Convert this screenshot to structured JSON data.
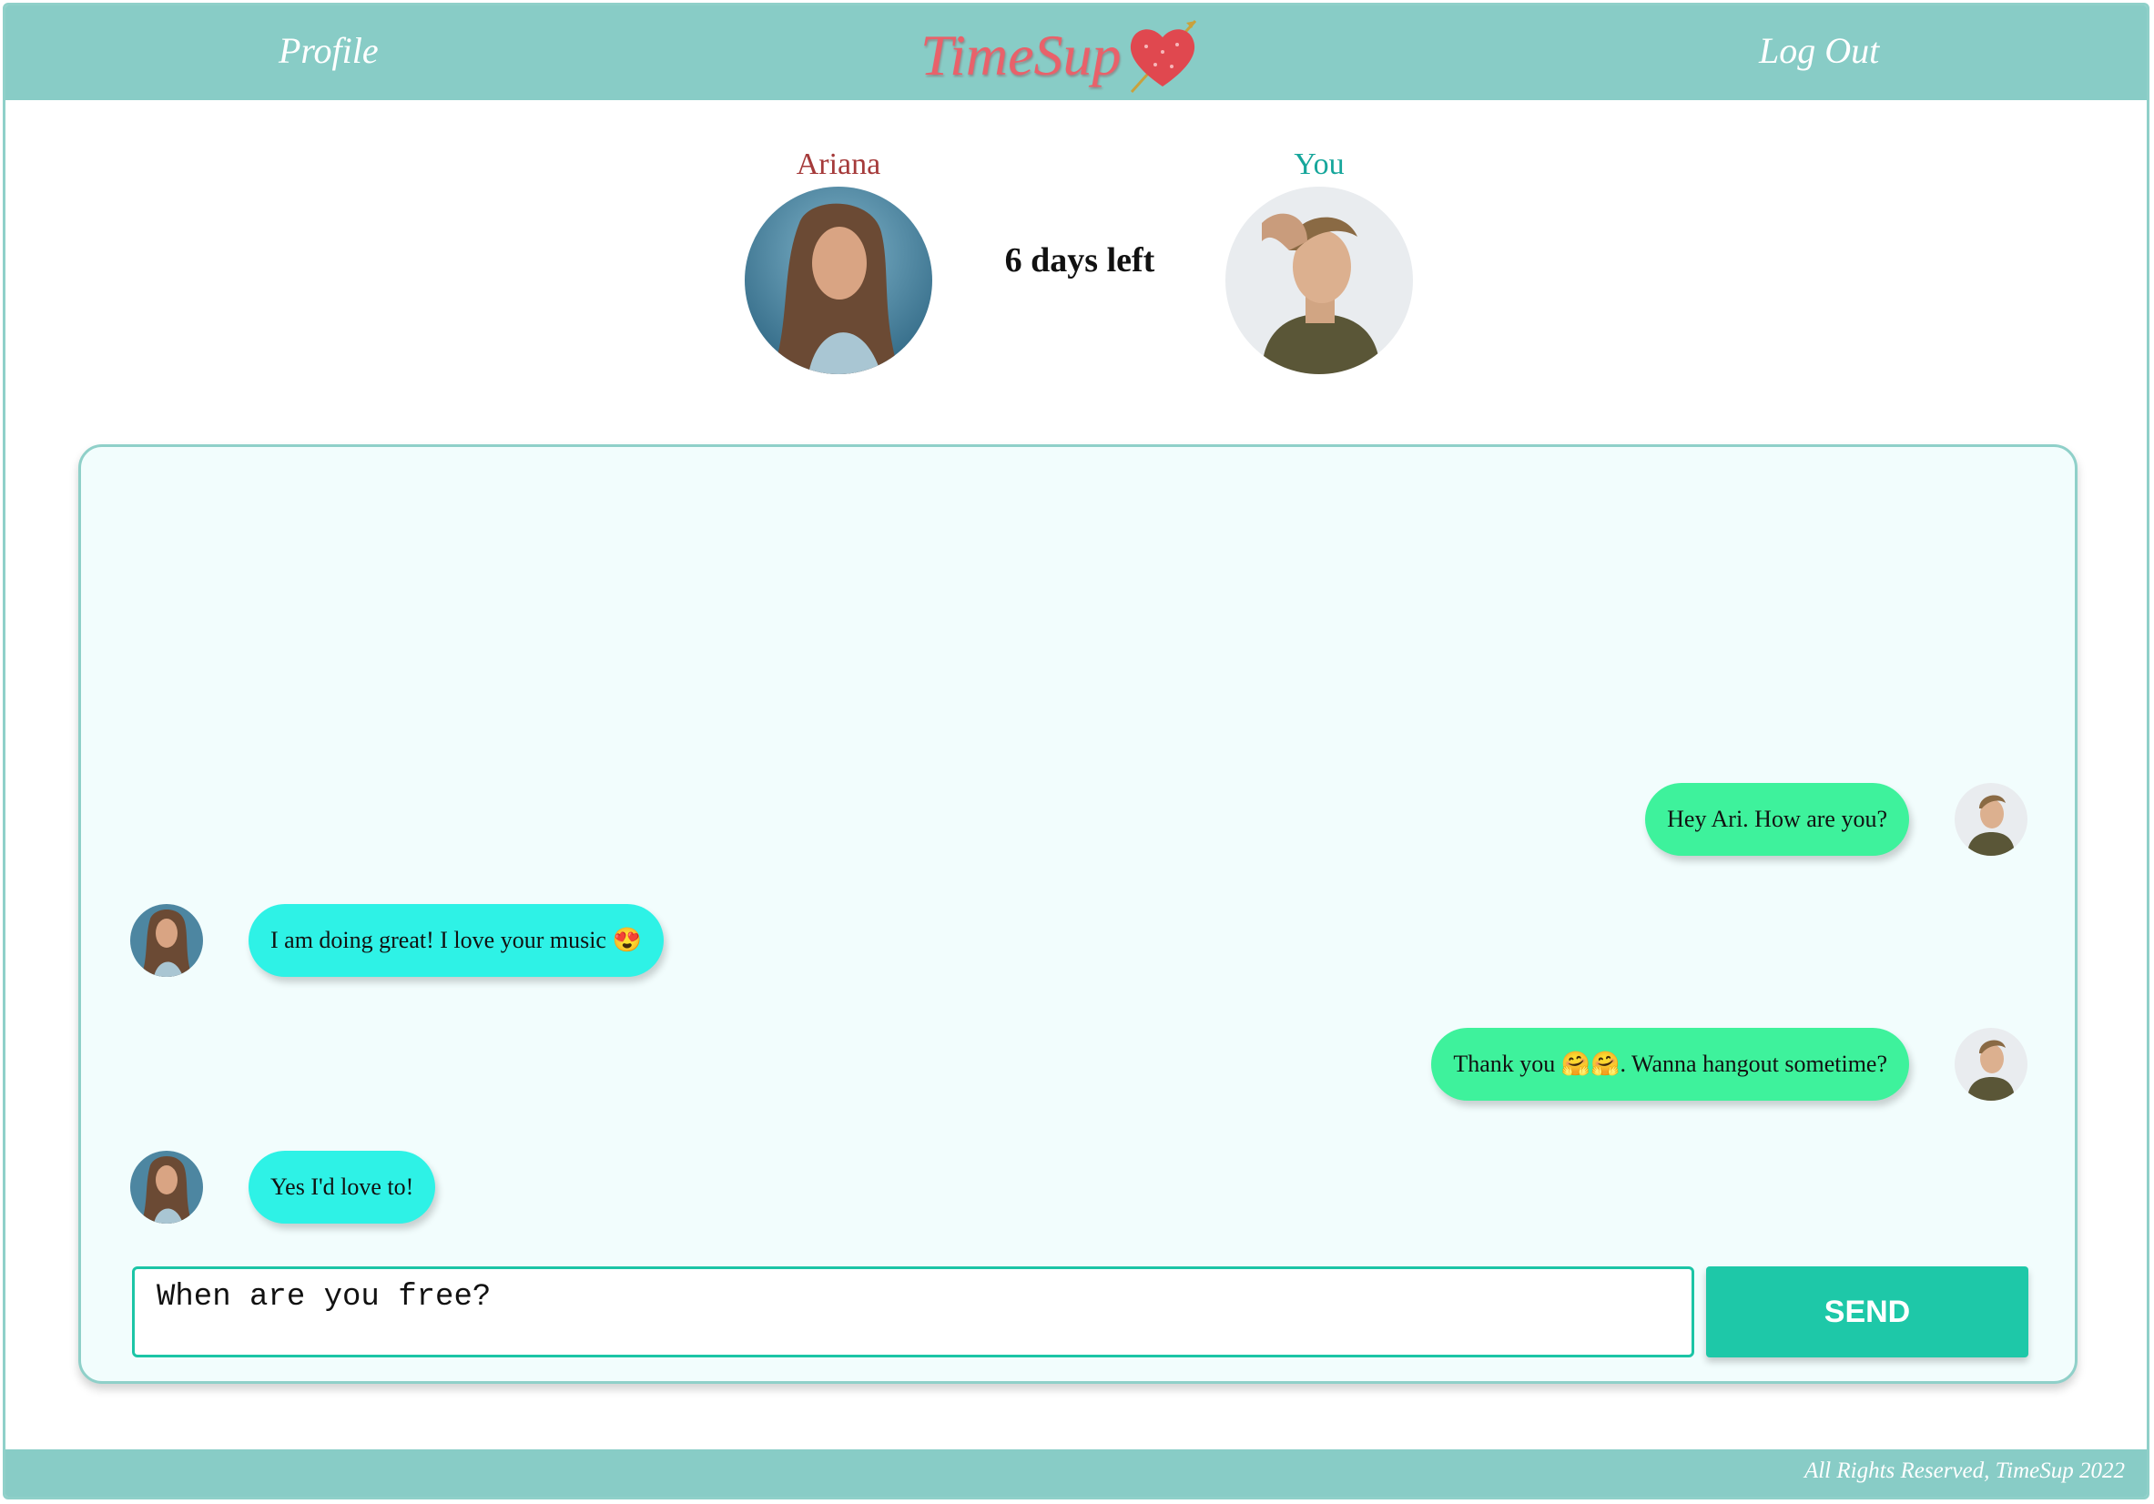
{
  "header": {
    "profile_label": "Profile",
    "logo_text": "TimeSup",
    "logout_label": "Log Out"
  },
  "match": {
    "left_name": "Ariana",
    "right_name": "You",
    "days_left": "6 days left"
  },
  "messages": [
    {
      "sender": "me",
      "text": "Hey Ari. How are you?"
    },
    {
      "sender": "them",
      "text": "I am doing great! I love your music 😍"
    },
    {
      "sender": "me",
      "text": "Thank you 🤗🤗. Wanna hangout sometime?"
    },
    {
      "sender": "them",
      "text": "Yes I'd love to!"
    }
  ],
  "composer": {
    "input_value": "When are you free?",
    "send_label": "SEND"
  },
  "footer": {
    "text": "All Rights Reserved, TimeSup 2022"
  },
  "colors": {
    "header_bg": "#88ccc6",
    "logo": "#e9616a",
    "bubble_me": "#3ef29c",
    "bubble_them": "#2ef2e6",
    "send_button": "#1ec8a8"
  }
}
